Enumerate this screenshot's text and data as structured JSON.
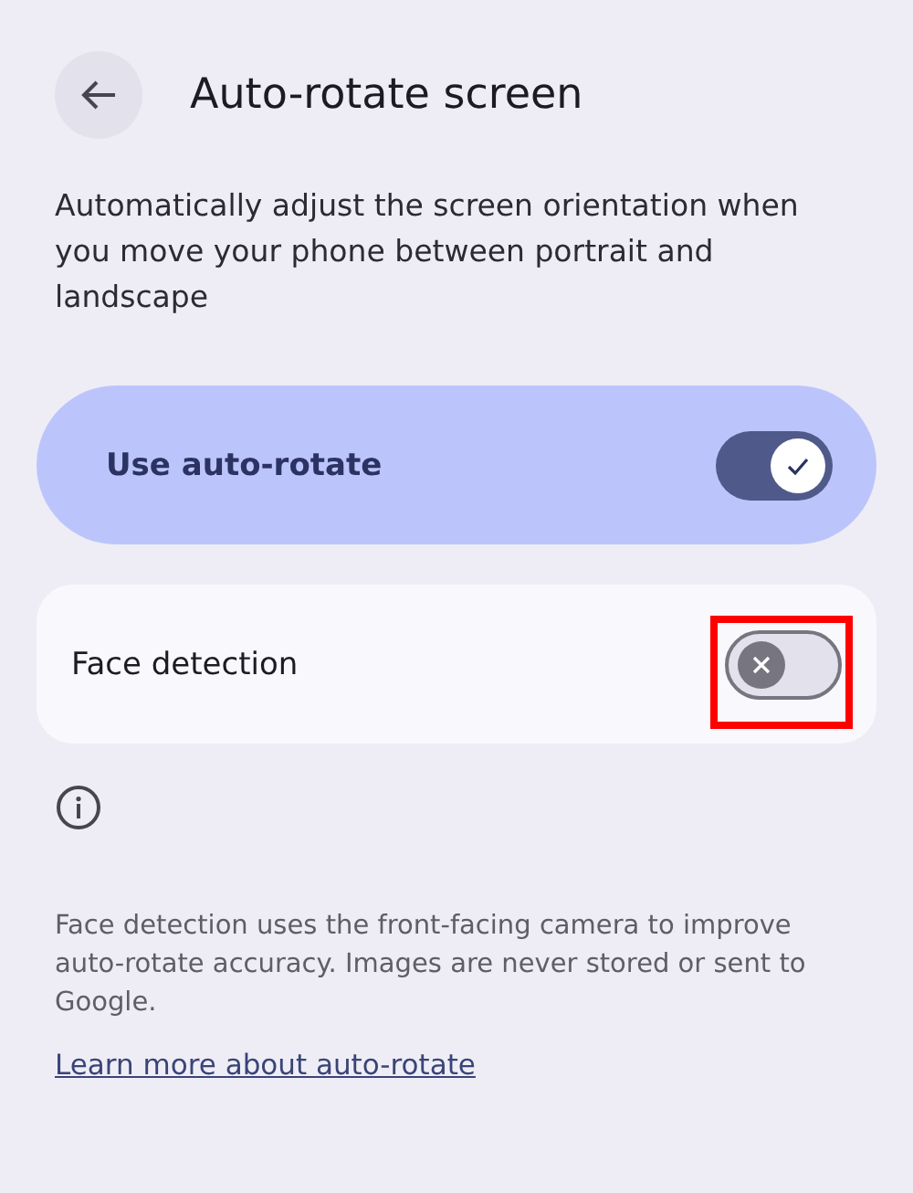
{
  "header": {
    "title": "Auto-rotate screen"
  },
  "description": "Automatically adjust the screen orientation when you move your phone between portrait and landscape",
  "settings": [
    {
      "kind": "main",
      "label": "Use auto-rotate",
      "on": true,
      "highlighted": false
    },
    {
      "kind": "row",
      "label": "Face detection",
      "on": false,
      "highlighted": true
    }
  ],
  "footer": {
    "text": "Face detection uses the front-facing camera to improve auto-rotate accuracy. Images are never stored or sent to Google.",
    "link": "Learn more about auto-rotate"
  }
}
